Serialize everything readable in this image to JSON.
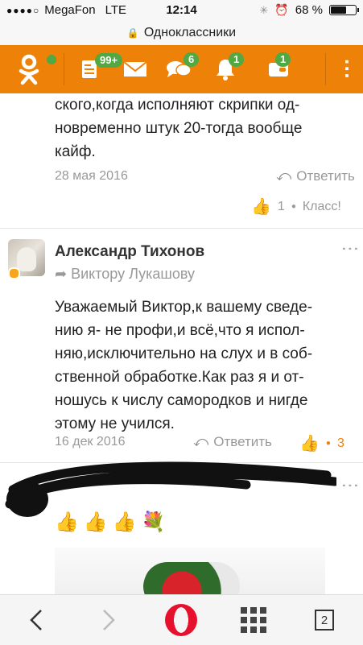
{
  "status_bar": {
    "carrier": "MegaFon",
    "network": "LTE",
    "time": "12:14",
    "battery": "68 %",
    "battery_level": 0.68
  },
  "url_bar": {
    "site": "Одноклассники"
  },
  "nav": {
    "items": [
      {
        "icon": "ok-logo-icon",
        "badge": ""
      },
      {
        "icon": "feed-icon",
        "badge": "99+"
      },
      {
        "icon": "mail-icon",
        "badge": ""
      },
      {
        "icon": "discussions-icon",
        "badge": "6"
      },
      {
        "icon": "bell-icon",
        "badge": "1"
      },
      {
        "icon": "wallet-icon",
        "badge": "1"
      }
    ],
    "accent_color": "#ee8208",
    "badge_color": "#52a843"
  },
  "comments": [
    {
      "text_lines": [
        "ского,когда исполняют скрипки од-",
        "новременно штук 20-тогда вообще",
        "кайф."
      ],
      "date": "28 мая 2016",
      "reply_label": "Ответить",
      "likes": "1",
      "like_label": "Класс!"
    },
    {
      "author": "Александр Тихонов",
      "reply_to": "Виктору Лукашову",
      "text_lines": [
        "Уважаемый Виктор,к вашему сведе-",
        "нию я- не профи,и всё,что я испол-",
        "няю,исключительно на слух и в соб-",
        "ственной обработке.Как раз я и от-",
        "ношусь к числу самородков и нигде",
        "этому не учился."
      ],
      "date": "16 дек 2016",
      "reply_label": "Ответить",
      "likes": "3"
    },
    {
      "emojis": [
        "👍",
        "👍",
        "👍",
        "💐"
      ]
    }
  ],
  "toolbar": {
    "back_icon": "back-icon",
    "forward_icon": "forward-icon",
    "tabs_count": "2"
  }
}
